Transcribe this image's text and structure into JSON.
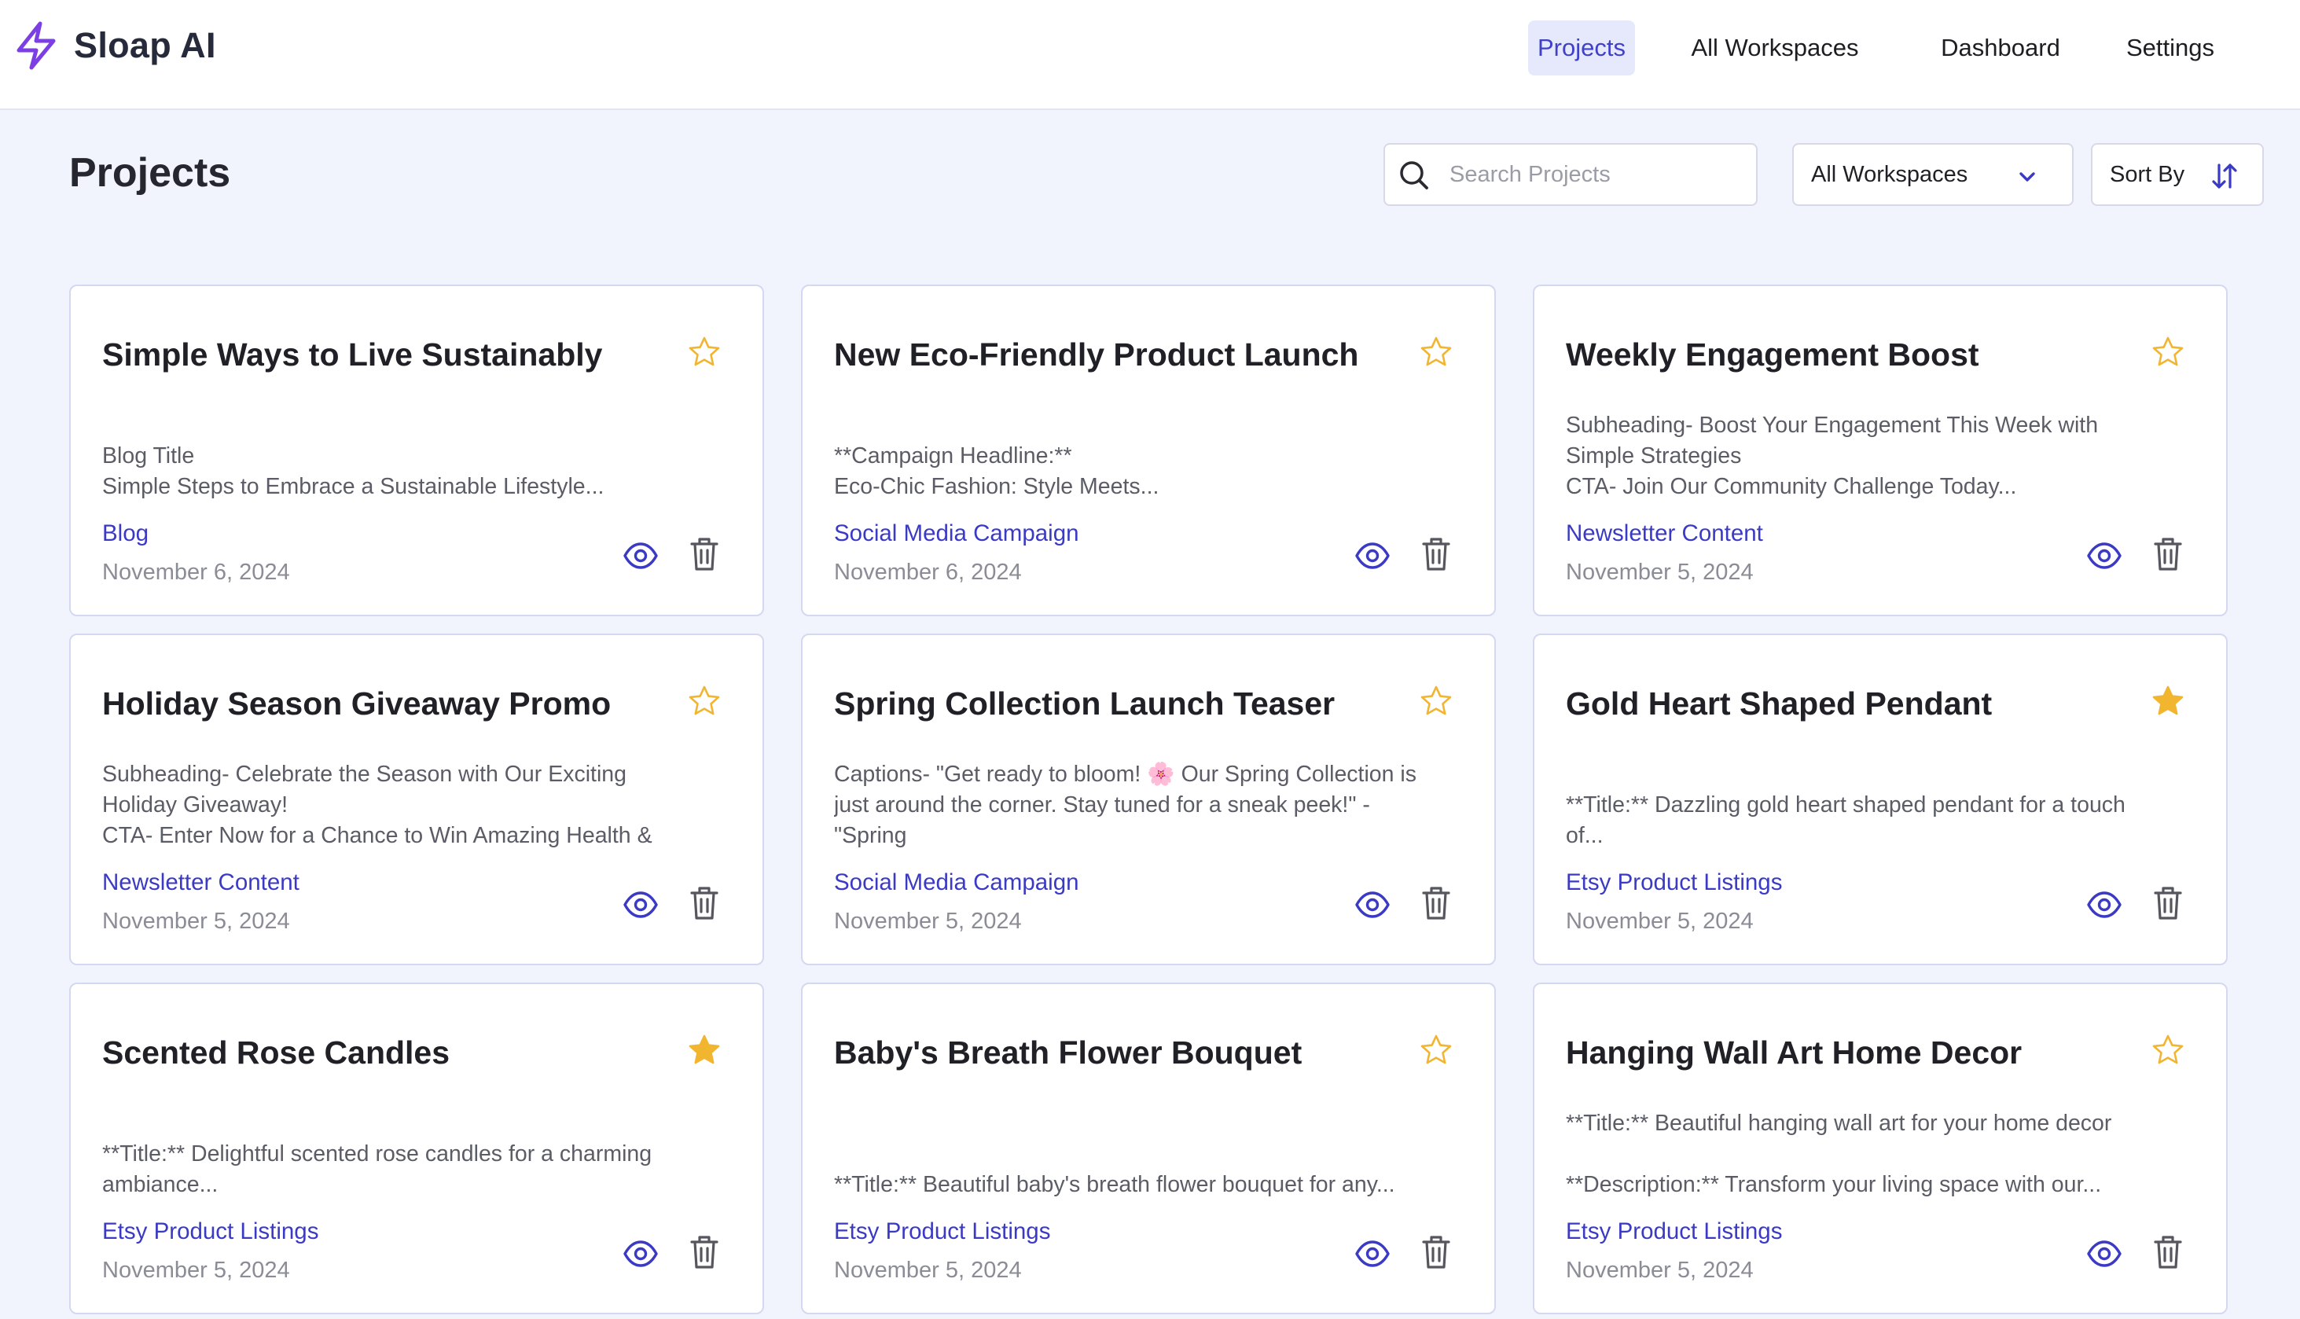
{
  "app": {
    "name": "Sloap AI"
  },
  "nav": {
    "items": [
      {
        "label": "Projects",
        "active": true
      },
      {
        "label": "All Workspaces",
        "active": false
      },
      {
        "label": "Dashboard",
        "active": false
      },
      {
        "label": "Settings",
        "active": false
      }
    ]
  },
  "page": {
    "title": "Projects"
  },
  "toolbar": {
    "search_placeholder": "Search Projects",
    "search_value": "",
    "workspace_select": "All Workspaces",
    "sort_label": "Sort By"
  },
  "colors": {
    "brand": "#7b3fe4",
    "accent": "#3b3ac4",
    "star": "#f2b530",
    "background": "#f1f3fd"
  },
  "icons": {
    "logo": "lightning-bolt-icon",
    "search": "search-icon",
    "dropdown": "chevron-down-icon",
    "sort": "sort-arrows-icon",
    "favorite": "star-icon",
    "view": "eye-icon",
    "delete": "trash-icon"
  },
  "cards": [
    {
      "title": "Simple Ways to Live Sustainably",
      "favorite": false,
      "desc": [
        "",
        "Blog Title",
        "Simple Steps to Embrace a Sustainable Lifestyle..."
      ],
      "type": "Blog",
      "date": "November 6, 2024"
    },
    {
      "title": "New Eco-Friendly Product Launch",
      "favorite": false,
      "desc": [
        "",
        "**Campaign Headline:**",
        "Eco-Chic Fashion: Style Meets..."
      ],
      "type": "Social Media Campaign",
      "date": "November 6, 2024"
    },
    {
      "title": "Weekly Engagement Boost",
      "favorite": false,
      "desc": [
        "Subheading- Boost Your Engagement This Week with",
        "Simple Strategies",
        "CTA- Join Our Community Challenge Today..."
      ],
      "type": "Newsletter Content",
      "date": "November 5, 2024"
    },
    {
      "title": "Holiday Season Giveaway Promo",
      "favorite": false,
      "desc": [
        "Subheading- Celebrate the Season with Our Exciting",
        "Holiday Giveaway!",
        "CTA- Enter Now for a Chance to Win Amazing Health &"
      ],
      "type": "Newsletter Content",
      "date": "November 5, 2024"
    },
    {
      "title": "Spring Collection Launch Teaser",
      "favorite": false,
      "desc": [
        "Captions- \"Get ready to bloom! 🌸 Our Spring Collection is",
        "just around the corner. Stay tuned for a sneak peek!\" -",
        "\"Spring"
      ],
      "type": "Social Media Campaign",
      "date": "November 5, 2024"
    },
    {
      "title": "Gold Heart Shaped Pendant",
      "favorite": true,
      "desc": [
        "",
        "**Title:** Dazzling gold heart shaped pendant for a touch",
        "of..."
      ],
      "type": "Etsy Product Listings",
      "date": "November 5, 2024"
    },
    {
      "title": "Scented Rose Candles",
      "favorite": true,
      "desc": [
        "",
        "**Title:** Delightful scented rose candles for a charming",
        "ambiance..."
      ],
      "type": "Etsy Product Listings",
      "date": "November 5, 2024"
    },
    {
      "title": "Baby's Breath Flower Bouquet",
      "favorite": false,
      "desc": [
        "",
        "",
        "**Title:** Beautiful baby's breath flower bouquet for any..."
      ],
      "type": "Etsy Product Listings",
      "date": "November 5, 2024"
    },
    {
      "title": "Hanging Wall Art Home Decor",
      "favorite": false,
      "desc": [
        "**Title:** Beautiful hanging wall art for your home decor",
        "",
        "**Description:** Transform your living space with our..."
      ],
      "type": "Etsy Product Listings",
      "date": "November 5, 2024"
    }
  ]
}
